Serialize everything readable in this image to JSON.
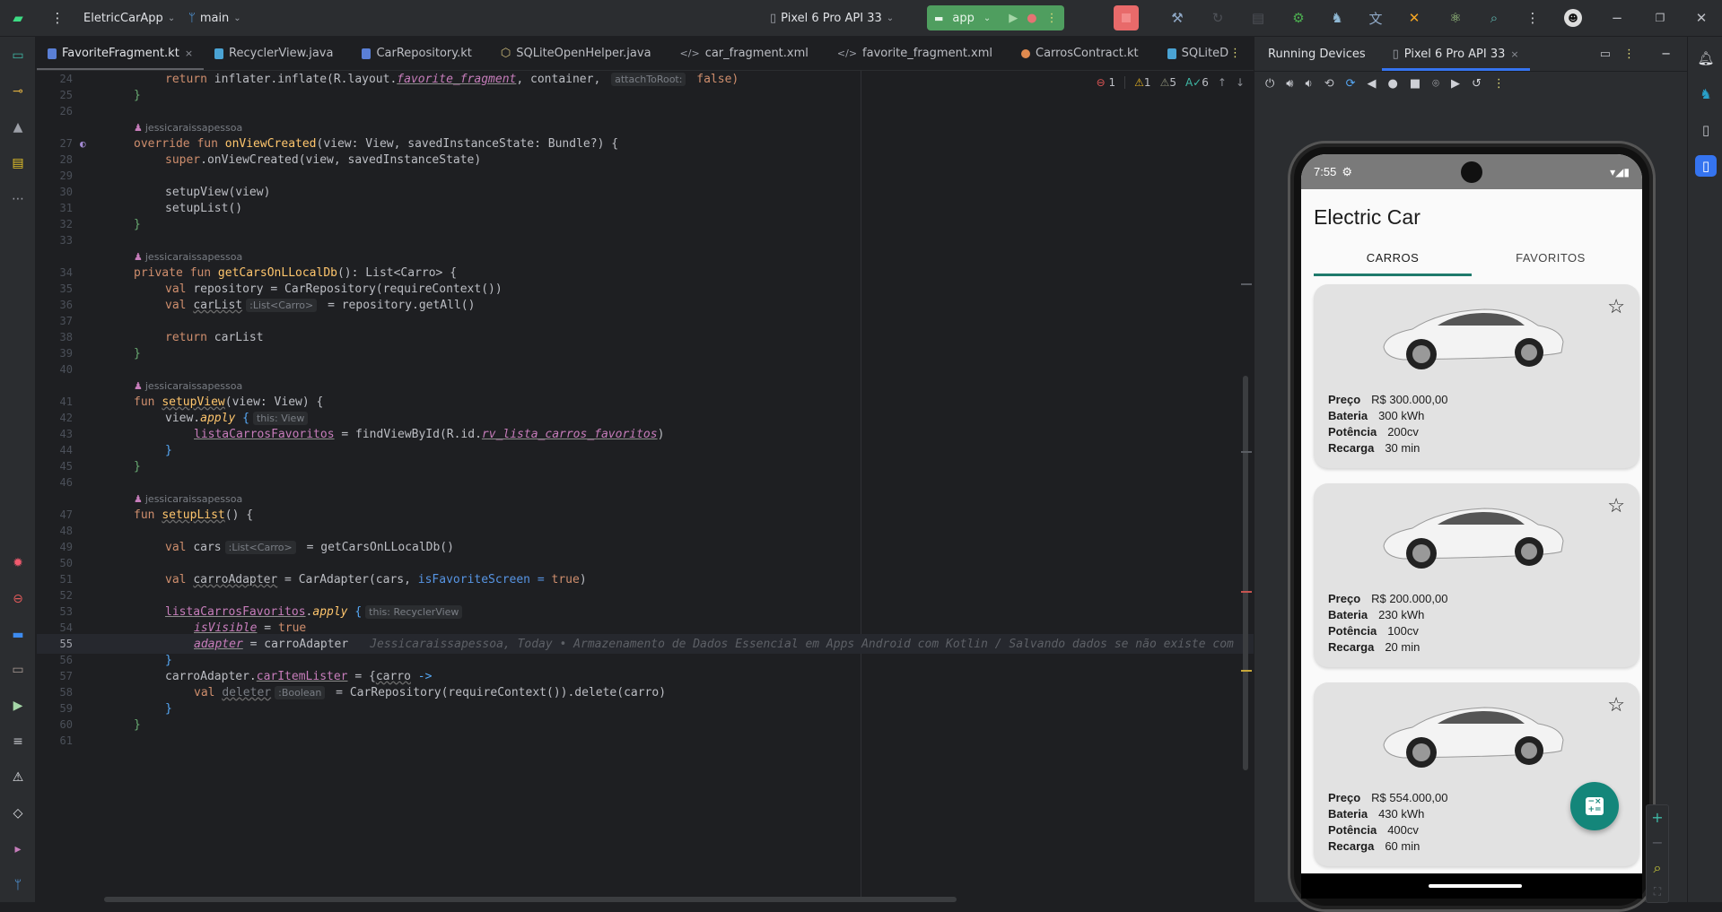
{
  "titlebar": {
    "project": "EletricCarApp",
    "branch": "main",
    "device": "Pixel 6 Pro API 33",
    "run_config": "app"
  },
  "editor_tabs": [
    {
      "label": "FavoriteFragment.kt",
      "color": "#5a7fd6",
      "active": true
    },
    {
      "label": "RecyclerView.java",
      "color": "#4aa3d4"
    },
    {
      "label": "CarRepository.kt",
      "color": "#5a7fd6"
    },
    {
      "label": "SQLiteOpenHelper.java",
      "color": "#c9b87a"
    },
    {
      "label": "car_fragment.xml",
      "color": "#9da0a8"
    },
    {
      "label": "favorite_fragment.xml",
      "color": "#9da0a8"
    },
    {
      "label": "CarrosContract.kt",
      "color": "#e08a4f"
    },
    {
      "label": "SQLiteD",
      "color": "#4aa3d4"
    }
  ],
  "inspections": {
    "errors": "1",
    "warnings": "1",
    "weak_warnings": "5",
    "typos": "6"
  },
  "code": {
    "author": "jessicaraissapessoa",
    "blame": "Jessicaraissapessoa, Today • Armazenamento de Dados Essencial em Apps Android com Kotlin / Salvando dados se não existe com",
    "lines": {
      "l24": {
        "num": "24",
        "a": "return ",
        "b": "inflater.inflate(R.layout.",
        "c": "favorite_fragment",
        "d": ", container, ",
        "hint": "attachToRoot:",
        "e": " false)"
      },
      "l25": {
        "num": "25",
        "a": "}"
      },
      "l26": {
        "num": "26"
      },
      "l27": {
        "num": "27",
        "a": "override fun ",
        "b": "onViewCreated",
        "c": "(view: View, savedInstanceState: Bundle?) {"
      },
      "l28": {
        "num": "28",
        "a": "super",
        "b": ".onViewCreated(view, savedInstanceState)"
      },
      "l29": {
        "num": "29"
      },
      "l30": {
        "num": "30",
        "a": "setupView(view)"
      },
      "l31": {
        "num": "31",
        "a": "setupList()"
      },
      "l32": {
        "num": "32",
        "a": "}"
      },
      "l33": {
        "num": "33"
      },
      "l34": {
        "num": "34",
        "a": "private fun ",
        "b": "getCarsOnLLocalDb",
        "c": "(): List<Carro> {"
      },
      "l35": {
        "num": "35",
        "a": "val ",
        "b": "repository = CarRepository(requireContext())"
      },
      "l36": {
        "num": "36",
        "a": "val ",
        "b": "carList",
        "hint": ":List<Carro>",
        "c": " = repository.getAll()"
      },
      "l37": {
        "num": "37"
      },
      "l38": {
        "num": "38",
        "a": "return ",
        "b": "carList"
      },
      "l39": {
        "num": "39",
        "a": "}"
      },
      "l40": {
        "num": "40"
      },
      "l41": {
        "num": "41",
        "a": "fun ",
        "b": "setupView",
        "c": "(view: View) {"
      },
      "l42": {
        "num": "42",
        "a": "view.",
        "b": "apply",
        "c": " {",
        "hint": "this: View"
      },
      "l43": {
        "num": "43",
        "a": "listaCarrosFavoritos",
        "b": " = findViewById(R.id.",
        "c": "rv_lista_carros_favoritos",
        "d": ")"
      },
      "l44": {
        "num": "44",
        "a": "}"
      },
      "l45": {
        "num": "45",
        "a": "}"
      },
      "l46": {
        "num": "46"
      },
      "l47": {
        "num": "47",
        "a": "fun ",
        "b": "setupList",
        "c": "() {"
      },
      "l48": {
        "num": "48"
      },
      "l49": {
        "num": "49",
        "a": "val ",
        "b": "cars",
        "hint": ":List<Carro>",
        "c": " = getCarsOnLLocalDb()"
      },
      "l50": {
        "num": "50"
      },
      "l51": {
        "num": "51",
        "a": "val ",
        "b": "carroAdapter",
        "c": " = CarAdapter(cars, ",
        "d": "isFavoriteScreen = ",
        "e": "true",
        "f": ")"
      },
      "l52": {
        "num": "52"
      },
      "l53": {
        "num": "53",
        "a": "listaCarrosFavoritos",
        "b": ".",
        "c": "apply",
        "d": " {",
        "hint": "this: RecyclerView"
      },
      "l54": {
        "num": "54",
        "a": "isVisible",
        "b": " = ",
        "c": "true"
      },
      "l55": {
        "num": "55",
        "a": "adapter",
        "b": " = carroAdapter"
      },
      "l56": {
        "num": "56",
        "a": "}"
      },
      "l57": {
        "num": "57",
        "a": "carroAdapter.",
        "b": "carItemLister",
        "c": " = {",
        "d": "carro",
        "e": " ->"
      },
      "l58": {
        "num": "58",
        "a": "val ",
        "b": "deleter",
        "hint": ":Boolean",
        "c": " = CarRepository(requireContext()).delete(carro)"
      },
      "l59": {
        "num": "59",
        "a": "}"
      },
      "l60": {
        "num": "60",
        "a": "}"
      },
      "l61": {
        "num": "61"
      }
    }
  },
  "device_panel": {
    "title": "Running Devices",
    "tab": "Pixel 6 Pro API 33"
  },
  "phone": {
    "time": "7:55",
    "app_title": "Electric Car",
    "tabs": [
      "CARROS",
      "FAVORITOS"
    ],
    "active_tab": "CARROS",
    "cars": [
      {
        "preco_label": "Preço",
        "preco": "R$ 300.000,00",
        "bateria_label": "Bateria",
        "bateria": "300 kWh",
        "potencia_label": "Potência",
        "potencia": "200cv",
        "recarga_label": "Recarga",
        "recarga": "30 min",
        "favorite": false
      },
      {
        "preco_label": "Preço",
        "preco": "R$ 200.000,00",
        "bateria_label": "Bateria",
        "bateria": "230 kWh",
        "potencia_label": "Potência",
        "potencia": "100cv",
        "recarga_label": "Recarga",
        "recarga": "20 min",
        "favorite": false
      },
      {
        "preco_label": "Preço",
        "preco": "R$ 554.000,00",
        "bateria_label": "Bateria",
        "bateria": "430 kWh",
        "potencia_label": "Potência",
        "potencia": "400cv",
        "recarga_label": "Recarga",
        "recarga": "60 min",
        "favorite": false
      }
    ],
    "fab_glyph": "-×\n+="
  },
  "colors": {
    "accent": "#1f7a6c",
    "fab": "#14867a",
    "run_green": "#4f9e5f",
    "stop_red": "#e86a6a"
  }
}
